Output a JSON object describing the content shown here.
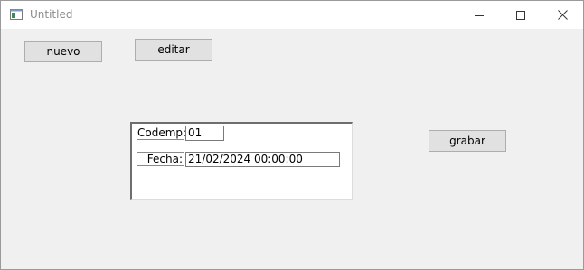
{
  "window": {
    "title": "Untitled",
    "icons": {
      "app": "app-window-icon",
      "minimize": "minimize-icon",
      "maximize": "maximize-icon",
      "close": "close-icon"
    }
  },
  "toolbar": {
    "nuevo_label": "nuevo",
    "editar_label": "editar",
    "grabar_label": "grabar"
  },
  "form": {
    "codemp_label": "Codemp:",
    "codemp_value": "01",
    "fecha_label": "Fecha:",
    "fecha_value": "21/02/2024 00:00:00"
  },
  "colors": {
    "window_bg": "#f0f0f0",
    "button_bg": "#e1e1e1",
    "button_border": "#adadad",
    "title_text": "#8c8c8c"
  }
}
